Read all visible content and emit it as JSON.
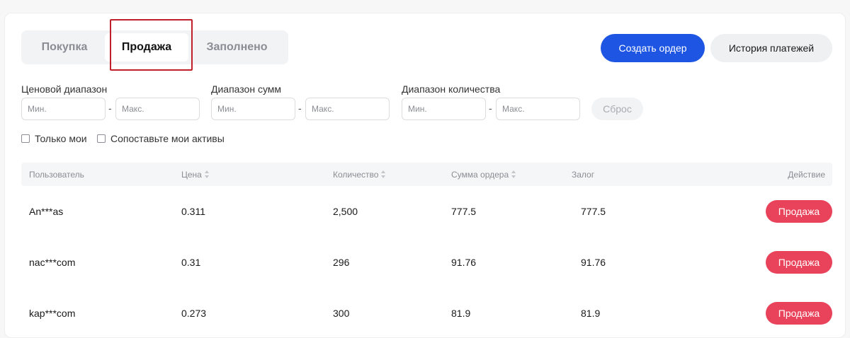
{
  "tabs": [
    {
      "label": "Покупка",
      "active": false
    },
    {
      "label": "Продажа",
      "active": true
    },
    {
      "label": "Заполнено",
      "active": false
    }
  ],
  "actions": {
    "create_order": "Создать ордер",
    "payment_history": "История платежей"
  },
  "filters": {
    "price_range": {
      "label": "Ценовой диапазон",
      "min_placeholder": "Мин.",
      "max_placeholder": "Макс."
    },
    "amount_range": {
      "label": "Диапазон сумм",
      "min_placeholder": "Мин.",
      "max_placeholder": "Макс."
    },
    "quantity_range": {
      "label": "Диапазон количества",
      "min_placeholder": "Мин.",
      "max_placeholder": "Макс."
    },
    "separator": "-",
    "reset": "Сброс",
    "only_mine": "Только мои",
    "match_assets": "Сопоставьте мои активы"
  },
  "table": {
    "headers": {
      "user": "Пользователь",
      "price": "Цена",
      "quantity": "Количество",
      "order_sum": "Сумма ордера",
      "collateral": "Залог",
      "action": "Действие"
    },
    "rows": [
      {
        "user": "An***as",
        "price": "0.311",
        "quantity": "2,500",
        "order_sum": "777.5",
        "collateral": "777.5",
        "action": "Продажа"
      },
      {
        "user": "nac***com",
        "price": "0.31",
        "quantity": "296",
        "order_sum": "91.76",
        "collateral": "91.76",
        "action": "Продажа"
      },
      {
        "user": "kap***com",
        "price": "0.273",
        "quantity": "300",
        "order_sum": "81.9",
        "collateral": "81.9",
        "action": "Продажа"
      }
    ]
  },
  "colors": {
    "primary": "#1e56e3",
    "sell": "#e8435a",
    "highlight": "#c0202a"
  }
}
